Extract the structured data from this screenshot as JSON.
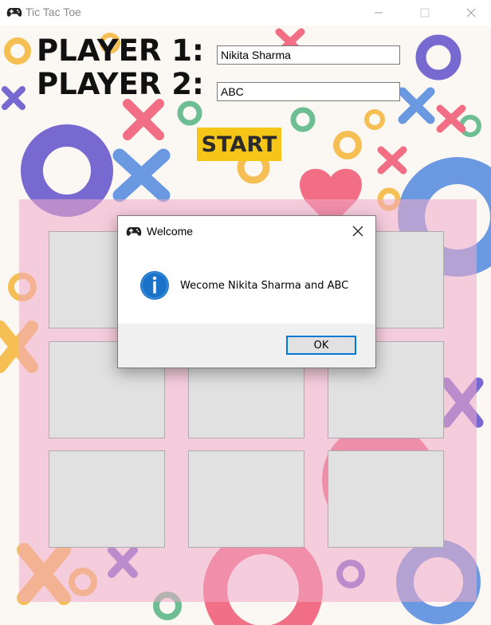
{
  "window": {
    "title": "Tic Tac Toe",
    "icon": "gamepad-icon",
    "controls": [
      "minimize-icon",
      "maximize-icon",
      "close-icon"
    ]
  },
  "players": {
    "p1_label": "PLAYER 1:",
    "p2_label": "PLAYER 2:",
    "p1_value": "Nikita Sharma",
    "p2_value": "ABC"
  },
  "start_label": "START",
  "board": {
    "cells": 9
  },
  "dialog": {
    "title": "Welcome",
    "icon": "info-icon",
    "message": "Wecome Nikita Sharma and ABC",
    "ok_label": "OK"
  },
  "colors": {
    "start": "#f5c518",
    "board_tint": "#f0aac8",
    "cell": "#e1e1e1",
    "accent": "#0078d7"
  }
}
